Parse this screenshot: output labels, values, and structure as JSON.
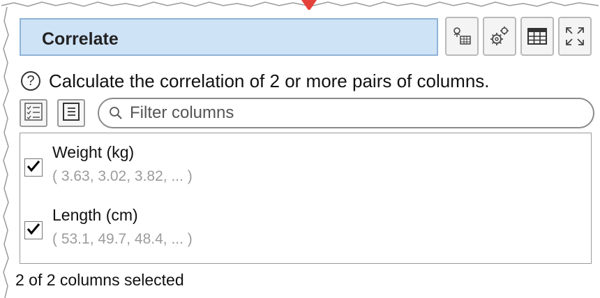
{
  "panel": {
    "title": "Correlate",
    "description": "Calculate the correlation of 2 or more pairs of columns."
  },
  "toolbar": {
    "icons": [
      "column-select-icon",
      "settings-gears-icon",
      "table-icon",
      "maximize-icon"
    ]
  },
  "filter": {
    "placeholder": "Filter columns",
    "value": ""
  },
  "columns": [
    {
      "name": "Weight (kg)",
      "preview": "( 3.63, 3.02, 3.82, ... )",
      "checked": true
    },
    {
      "name": "Length (cm)",
      "preview": "( 53.1, 49.7, 48.4, ... )",
      "checked": true
    }
  ],
  "status": "2 of 2 columns selected",
  "colors": {
    "title_bg": "#cfe3f7",
    "title_border": "#8fb2d6",
    "pointer": "#e5413b",
    "preview_text": "#9c9c9c"
  }
}
